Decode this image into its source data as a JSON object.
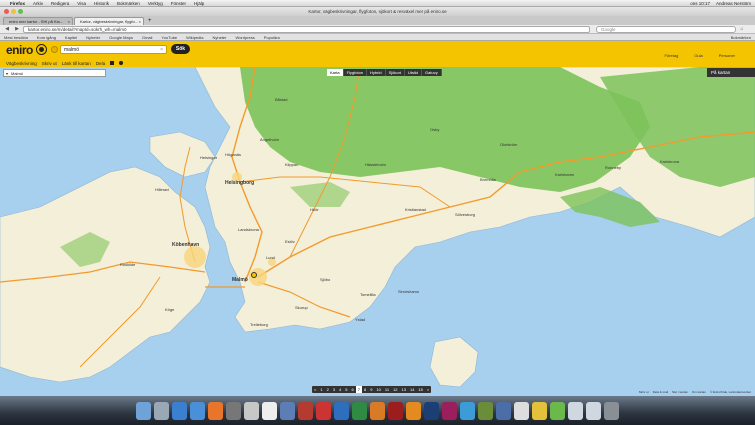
{
  "menubar": {
    "items": [
      "Firefox",
      "Arkiv",
      "Redigera",
      "Visa",
      "Historik",
      "Bokmärken",
      "Verktyg",
      "Fönster",
      "Hjälp"
    ],
    "clock": "ons 10:17",
    "user": "Andreas Nerstöm"
  },
  "window": {
    "title": "Kartor, vägbeskrivningar, flygfoton, sjökort & resväxel mer på eniro.se"
  },
  "tabs": [
    {
      "label": "eniro mer kartor - SHi på Kla..."
    },
    {
      "label": "Kartor, vägbeskrivningar, flygfo..."
    }
  ],
  "nav": {
    "url": "kartor.eniro.se/m/detail?mapId=sokrh_wh=malmö",
    "search_placeholder": "Google"
  },
  "bookmarks": {
    "items": [
      "Mest besökta",
      "Kom igång",
      "Kapitel",
      "Nyheter",
      "Google Maps",
      "Gmail",
      "YouTube",
      "Wikipedia",
      "Nyheter",
      "Wordpress",
      "Populära"
    ],
    "right": "Bokmärken"
  },
  "eniro": {
    "logo": "eniro",
    "search_value": "malmö",
    "search_button": "Sök",
    "top_links": [
      "Företag",
      "Gula",
      "Personer"
    ],
    "subnav": [
      "Vägbeskrivning",
      "Skriv ut",
      "Länk till kartan",
      "Dela"
    ]
  },
  "map": {
    "results_label": "Malmö",
    "map_types": [
      "Karta",
      "Flygfoton",
      "Hybrid",
      "Sjökort",
      "Utsikt",
      "Gatuvy"
    ],
    "active_map_type": "Karta",
    "pa_kartan": "På kartan",
    "cities": [
      {
        "name": "Helsingborg",
        "big": true
      },
      {
        "name": "Köbenhavn",
        "big": true
      },
      {
        "name": "Malmö",
        "big": true
      },
      {
        "name": "Lund",
        "big": false
      },
      {
        "name": "Trelleborg",
        "big": false
      },
      {
        "name": "Ystad",
        "big": false
      },
      {
        "name": "Landskrona",
        "big": false
      },
      {
        "name": "Kristianstad",
        "big": false
      },
      {
        "name": "Sölvesborg",
        "big": false
      },
      {
        "name": "Karlshamn",
        "big": false
      },
      {
        "name": "Karlskrona",
        "big": false
      },
      {
        "name": "Ängelholm",
        "big": false
      },
      {
        "name": "Höör",
        "big": false
      },
      {
        "name": "Hässleholm",
        "big": false
      },
      {
        "name": "Simrishamn",
        "big": false
      },
      {
        "name": "Roskilde",
        "big": false
      },
      {
        "name": "Hillerød",
        "big": false
      },
      {
        "name": "Helsingør",
        "big": false
      },
      {
        "name": "Köge",
        "big": false
      },
      {
        "name": "Eslöv",
        "big": false
      },
      {
        "name": "Sjöbo",
        "big": false
      },
      {
        "name": "Skurup",
        "big": false
      },
      {
        "name": "Tomelilla",
        "big": false
      },
      {
        "name": "Höganäs",
        "big": false
      },
      {
        "name": "Båstad",
        "big": false
      },
      {
        "name": "Klippan",
        "big": false
      },
      {
        "name": "Osby",
        "big": false
      },
      {
        "name": "Olofström",
        "big": false
      },
      {
        "name": "Ronneby",
        "big": false
      },
      {
        "name": "Bromölla",
        "big": false
      }
    ],
    "pager": [
      "<",
      "1",
      "2",
      "3",
      "4",
      "5",
      "6",
      "7",
      "8",
      "9",
      "10",
      "11",
      "12",
      "13",
      "14",
      "15",
      ">"
    ],
    "active_page": "7",
    "attribution": [
      "Skriv ut",
      "Dela & mail",
      "Mer i kartan",
      "Om kartan",
      "© Eniro/Krak, Lantmäteriverket"
    ]
  },
  "colors": {
    "eniro_yellow": "#f5c400",
    "water": "#a7cfee",
    "land": "#f3efd8",
    "forest": "#7cc25a",
    "road": "#f39a2b"
  }
}
